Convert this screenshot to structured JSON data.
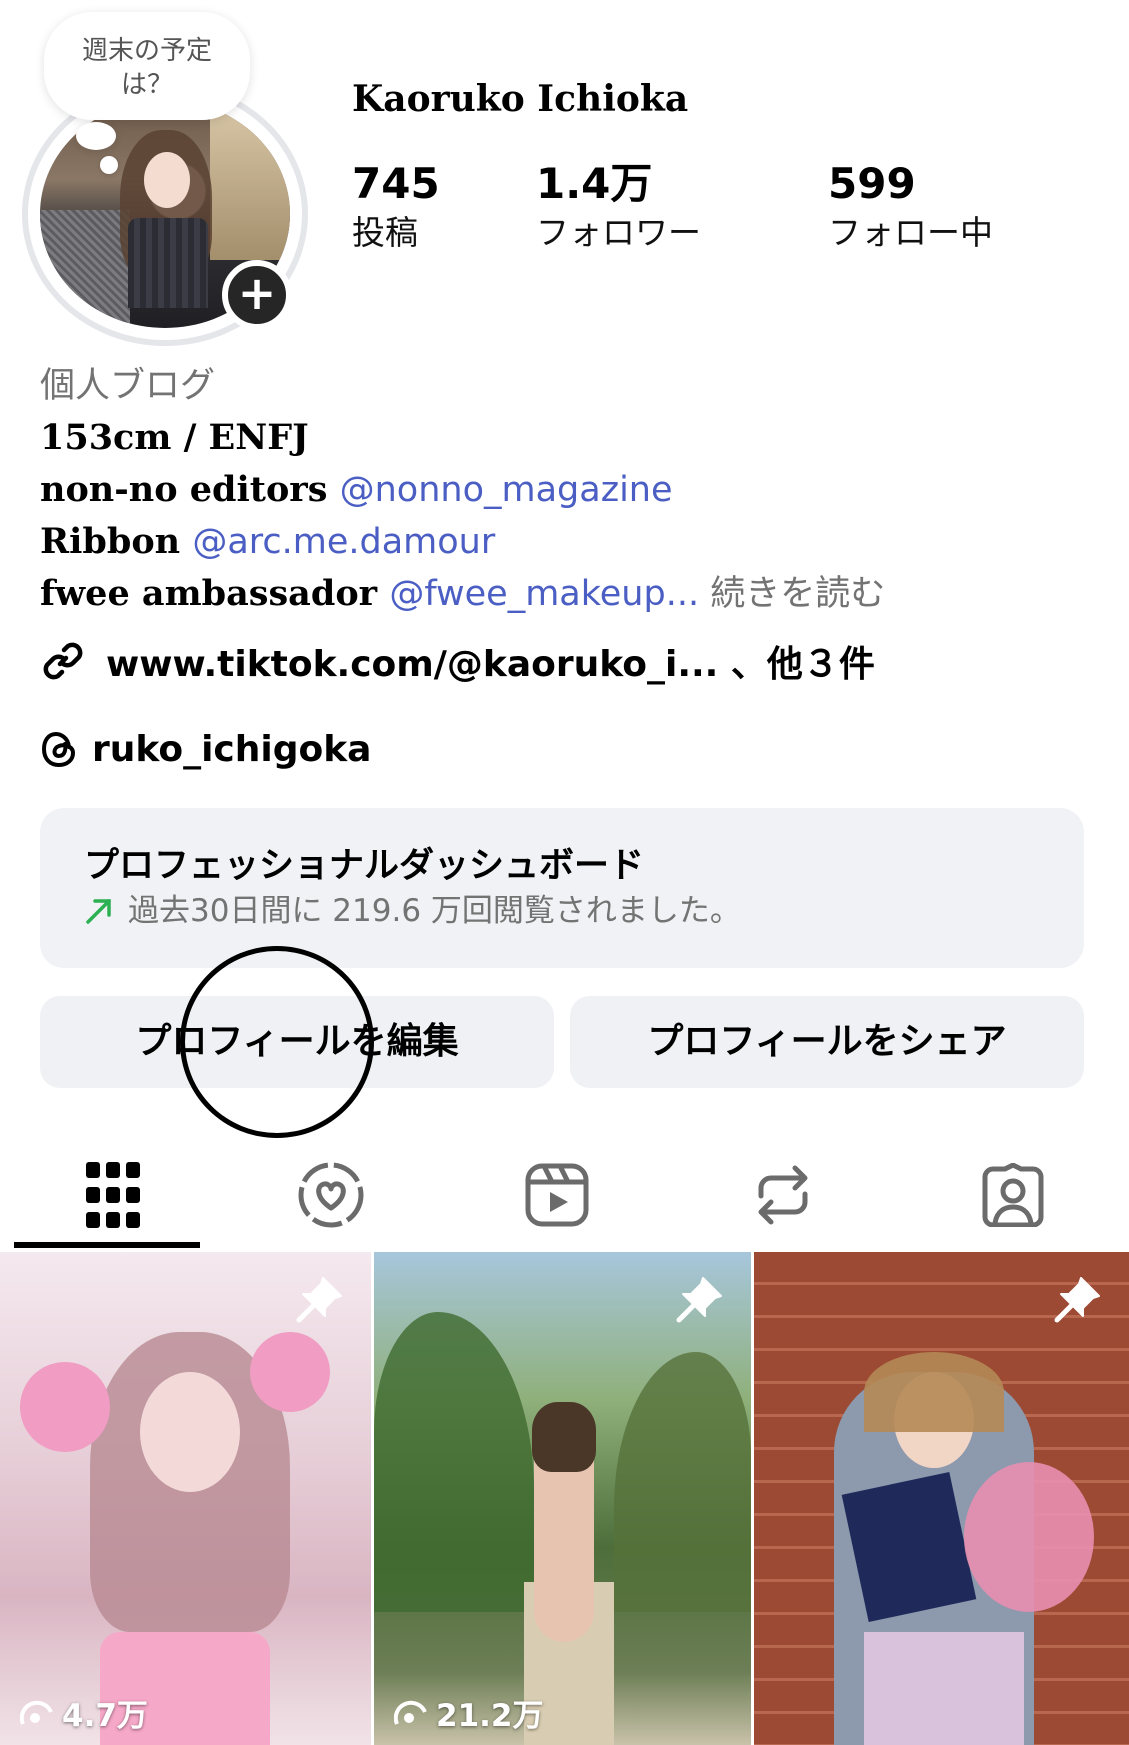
{
  "profile": {
    "note": [
      "週末の予定",
      "は？"
    ],
    "username": "Kaoruko Ichioka",
    "stats": [
      {
        "value": "745",
        "label": "投稿"
      },
      {
        "value": "1.4万",
        "label": "フォロワー"
      },
      {
        "value": "599",
        "label": "フォロー中"
      }
    ]
  },
  "bio": {
    "category": "個人ブログ",
    "line1": "153cm / ENFJ",
    "line2_text": "non-no editors ",
    "line2_mention": "@nonno_magazine",
    "line3_text": "Ribbon ",
    "line3_mention": "@arc.me.damour",
    "line4_text": "fwee ambassador ",
    "line4_mention": "@fwee_makeup...",
    "line4_more": " 続きを読む",
    "link": "www.tiktok.com/@kaoruko_i... 、他３件",
    "threads": "ruko_ichigoka"
  },
  "dashboard": {
    "title": "プロフェッショナルダッシュボード",
    "subtitle": "過去30日間に 219.6 万回閲覧されました。"
  },
  "buttons": {
    "edit": "プロフィールを編集",
    "share": "プロフィールをシェア"
  },
  "tabs": [
    "grid-icon",
    "collab-icon",
    "reels-icon",
    "reposts-icon",
    "tagged-icon"
  ],
  "grid": [
    {
      "views": "4.7万",
      "pinned": true
    },
    {
      "views": "21.2万",
      "pinned": true
    },
    {
      "views": "",
      "pinned": true
    }
  ],
  "colors": {
    "mention": "#4a5ec4",
    "trend_up": "#2bb052",
    "button_bg": "#eff1f4"
  }
}
